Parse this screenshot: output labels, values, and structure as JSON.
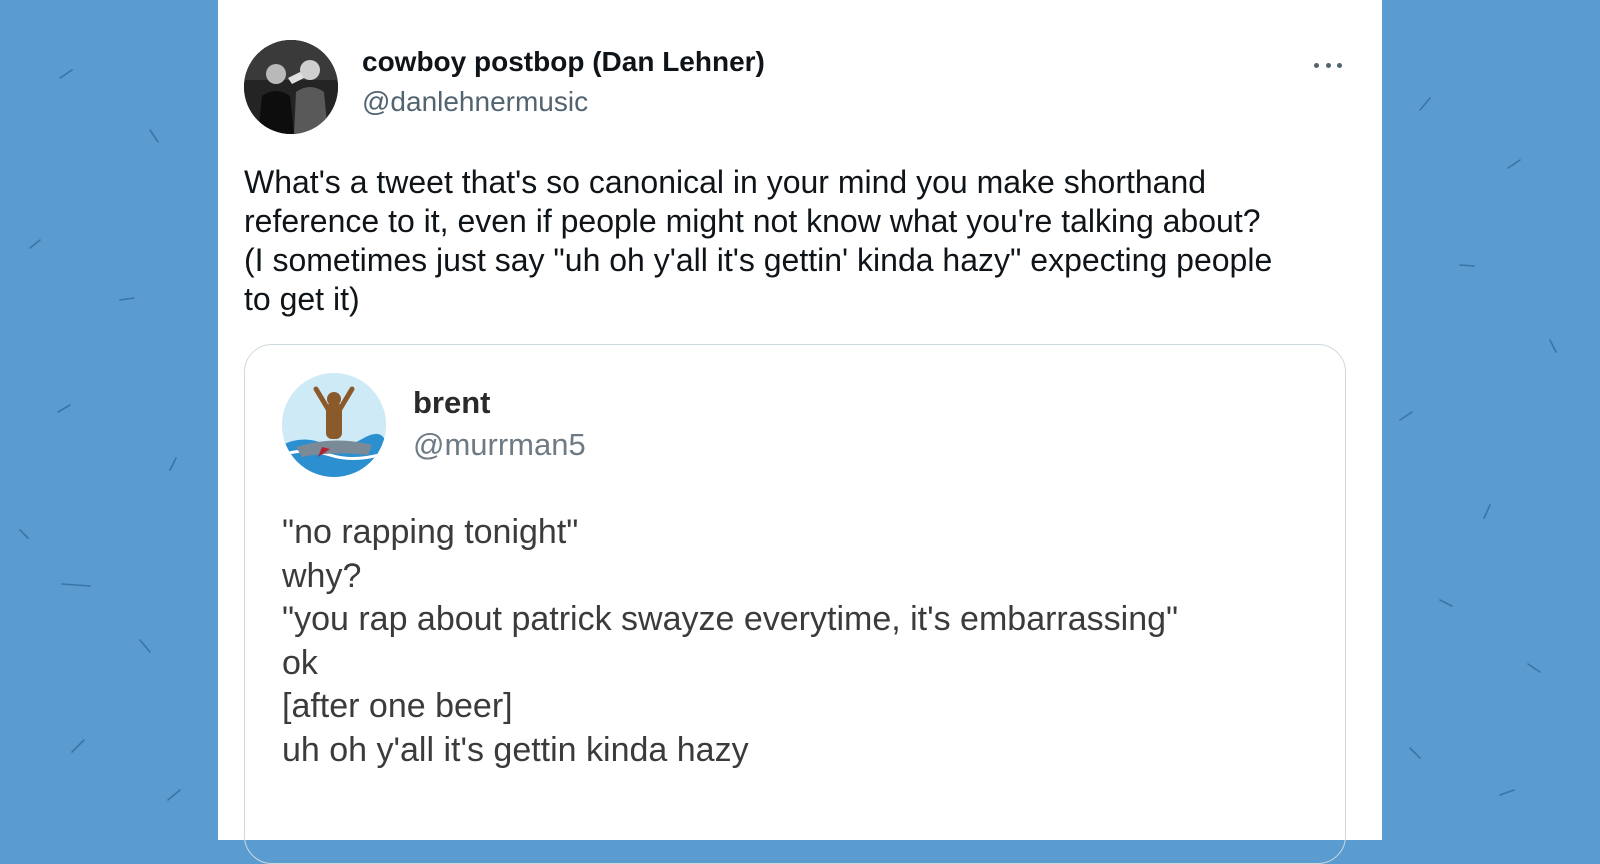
{
  "tweet": {
    "author_name": "cowboy postbop (Dan Lehner)",
    "author_handle": "@danlehnermusic",
    "text_lines": [
      "What's a tweet that's so canonical in your mind you make shorthand",
      "reference to it, even if people might not know what you're talking about?",
      "(I sometimes just say \"uh oh y'all it's gettin' kinda hazy\" expecting people",
      "to get it)"
    ]
  },
  "quoted_tweet": {
    "author_name": "brent",
    "author_handle": "@murrman5",
    "text_lines": [
      "\"no rapping tonight\"",
      "why?",
      "\"you rap about patrick swayze everytime, it's embarrassing\"",
      "ok",
      "[after one beer]",
      "uh oh y'all it's gettin kinda hazy"
    ]
  },
  "icons": {
    "more": "more-options-icon",
    "author_avatar": "avatar-photo",
    "quoted_avatar": "avatar-illustration"
  },
  "colors": {
    "background": "#5a9bd0",
    "card": "#ffffff",
    "text_primary": "#0f1419",
    "text_secondary": "#536471",
    "quote_border": "#cfd9de"
  }
}
